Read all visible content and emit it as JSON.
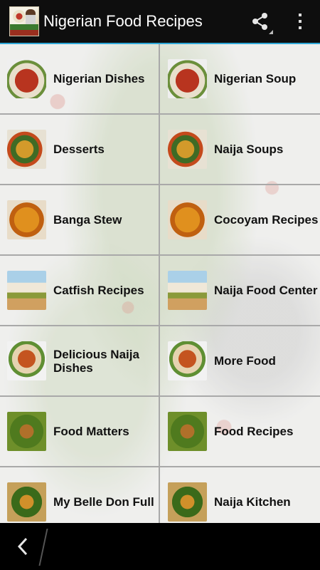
{
  "actionbar": {
    "title": "Nigerian Food Recipes",
    "app_icon": "app-logo",
    "share_icon": "share-icon",
    "overflow_icon": "overflow-menu-icon"
  },
  "grid": [
    {
      "label": "Nigerian Dishes",
      "thumb": "t-rice"
    },
    {
      "label": "Nigerian Soup",
      "thumb": "t-rice"
    },
    {
      "label": "Desserts",
      "thumb": "t-soup"
    },
    {
      "label": "Naija Soups",
      "thumb": "t-soup"
    },
    {
      "label": "Banga Stew",
      "thumb": "t-stew"
    },
    {
      "label": "Cocoyam Recipes",
      "thumb": "t-stew"
    },
    {
      "label": "Catfish Recipes",
      "thumb": "t-fish"
    },
    {
      "label": "Naija Food Center",
      "thumb": "t-fish"
    },
    {
      "label": "Delicious Naija Dishes",
      "thumb": "t-yam"
    },
    {
      "label": "More Food",
      "thumb": "t-yam"
    },
    {
      "label": "Food Matters",
      "thumb": "t-veg"
    },
    {
      "label": "Food Recipes",
      "thumb": "t-veg"
    },
    {
      "label": "My Belle Don Full",
      "thumb": "t-mix"
    },
    {
      "label": "Naija Kitchen",
      "thumb": "t-mix"
    }
  ],
  "navbar": {
    "back_icon": "back-icon"
  },
  "colors": {
    "actionbar_bg": "#0e0e0e",
    "accent": "#2fa8d8",
    "divider": "#a9a9a9"
  }
}
